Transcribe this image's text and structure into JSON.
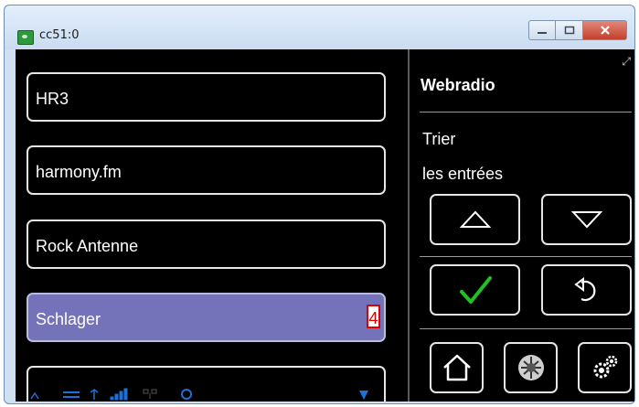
{
  "window": {
    "title": "cc51:0"
  },
  "stations": [
    {
      "label": "HR3",
      "selected": false
    },
    {
      "label": "harmony.fm",
      "selected": false
    },
    {
      "label": "Rock Antenne",
      "selected": false
    },
    {
      "label": "Schlager",
      "selected": true,
      "badge": "4"
    }
  ],
  "panel": {
    "title": "Webradio",
    "sort_line1": "Trier",
    "sort_line2": "les entrées"
  },
  "buttons": {
    "up": "up-arrow-icon",
    "down": "down-arrow-icon",
    "confirm": "checkmark-icon",
    "back": "back-arrow-icon",
    "home": "home-icon",
    "media": "speaker-icon",
    "settings": "gears-icon"
  },
  "colors": {
    "background": "#000000",
    "selected": "#7472b8",
    "badge": "#e00000",
    "status_icons": "#1e6fd6",
    "check": "#1fc21f"
  }
}
